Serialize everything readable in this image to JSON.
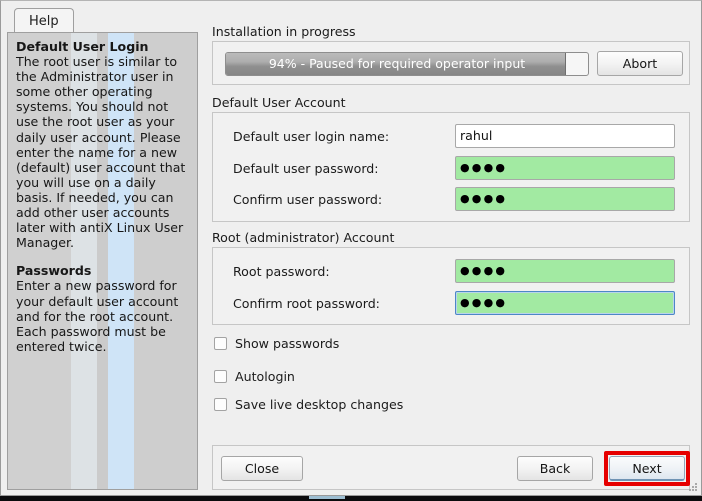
{
  "window": {
    "help_pane": {
      "tab_label": "Help",
      "sections": [
        {
          "heading": "Default User Login",
          "body": "The root user is similar to the Administrator user in some other operating systems. You should not use the root user as your daily user account. Please enter the name for a new (default) user account that you will use on a daily basis. If needed, you can add other user accounts later with antiX Linux User Manager."
        },
        {
          "heading": "Passwords",
          "body": "Enter a new password for your default user account and for the root account. Each password must be entered twice."
        }
      ]
    },
    "progress": {
      "section_label": "Installation in progress",
      "percent": 94,
      "bar_text": "94% - Paused for required operator input",
      "abort_label": "Abort"
    },
    "default_user_account": {
      "section_label": "Default User Account",
      "fields": [
        {
          "label": "Default user login name:",
          "value": "rahul",
          "masked": false,
          "focused": false
        },
        {
          "label": "Default user password:",
          "value": "●●●●",
          "masked": true,
          "focused": false
        },
        {
          "label": "Confirm user password:",
          "value": "●●●●",
          "masked": true,
          "focused": false
        }
      ]
    },
    "root_account": {
      "section_label": "Root (administrator) Account",
      "fields": [
        {
          "label": "Root password:",
          "value": "●●●●",
          "masked": true,
          "focused": false
        },
        {
          "label": "Confirm root password:",
          "value": "●●●●",
          "masked": true,
          "focused": true
        }
      ]
    },
    "checkboxes": [
      {
        "label": "Show passwords",
        "checked": false
      },
      {
        "label": "Autologin",
        "checked": false
      },
      {
        "label": "Save live desktop changes",
        "checked": false
      }
    ],
    "footer": {
      "close_label": "Close",
      "back_label": "Back",
      "next_label": "Next"
    }
  },
  "colors": {
    "password_field_green": "#a2eaa2",
    "focus_border_blue": "#4d87c7",
    "highlight_red": "#e60000",
    "window_background": "#efefef"
  }
}
